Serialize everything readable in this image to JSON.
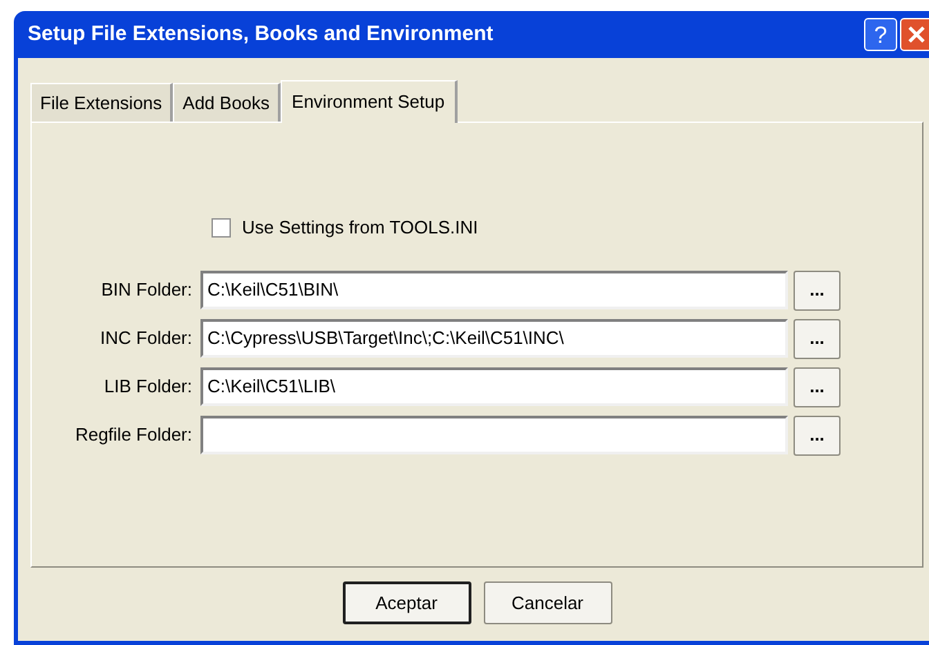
{
  "window": {
    "title": "Setup File Extensions, Books and Environment",
    "help": "?"
  },
  "tabs": [
    {
      "label": "File Extensions",
      "selected": false
    },
    {
      "label": "Add Books",
      "selected": false
    },
    {
      "label": "Environment Setup",
      "selected": true
    }
  ],
  "checkbox": {
    "label": "Use Settings from TOOLS.INI",
    "checked": false
  },
  "folders": [
    {
      "label": "BIN Folder:",
      "value": "C:\\Keil\\C51\\BIN\\",
      "browse": "..."
    },
    {
      "label": "INC Folder:",
      "value": "C:\\Cypress\\USB\\Target\\Inc\\;C:\\Keil\\C51\\INC\\",
      "browse": "..."
    },
    {
      "label": "LIB Folder:",
      "value": "C:\\Keil\\C51\\LIB\\",
      "browse": "..."
    },
    {
      "label": "Regfile Folder:",
      "browse": "..."
    }
  ],
  "buttons": [
    {
      "label": "Aceptar",
      "default": true
    },
    {
      "label": "Cancelar",
      "default": false
    }
  ]
}
